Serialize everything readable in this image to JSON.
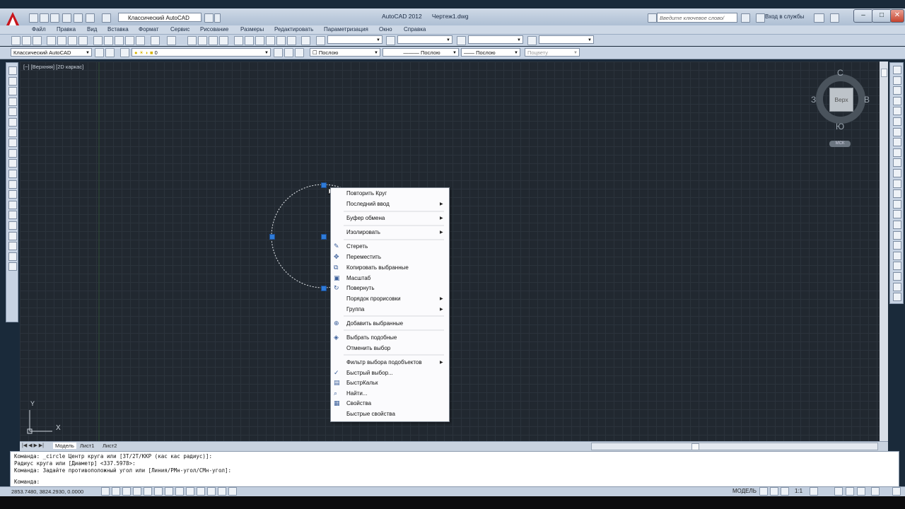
{
  "titlebar": {
    "app_name": "AutoCAD 2012",
    "document": "Чертеж1.dwg",
    "workspace": "Классический AutoCAD",
    "search_placeholder": "Введите ключевое слово/фразу",
    "login": "Вход в службы",
    "minimize": "–",
    "maximize": "□",
    "close": "✕"
  },
  "menubar": [
    "Файл",
    "Правка",
    "Вид",
    "Вставка",
    "Формат",
    "Сервис",
    "Рисование",
    "Размеры",
    "Редактировать",
    "Параметризация",
    "Окно",
    "Справка"
  ],
  "toolbar2": {
    "workspace": "Классический AutoCAD",
    "layer": "0",
    "color": "Послою",
    "linetype": "Послою",
    "lineweight": "Послою",
    "plotstyle": "Поцвету"
  },
  "viewport": {
    "label": "[−] [Верхняя] [2D каркас]"
  },
  "viewcube": {
    "north": "С",
    "south": "Ю",
    "east": "В",
    "west": "З",
    "face": "Верх",
    "wcs": "МСК"
  },
  "ucs": {
    "x": "X",
    "y": "Y"
  },
  "context_menu": {
    "items": [
      {
        "label": "Повторить Круг",
        "submenu": false
      },
      {
        "label": "Последний ввод",
        "submenu": true
      },
      {
        "label": "Буфер обмена",
        "submenu": true
      },
      {
        "label": "Изолировать",
        "submenu": true
      },
      {
        "label": "Стереть",
        "submenu": false,
        "icon": "eraser-icon"
      },
      {
        "label": "Переместить",
        "submenu": false,
        "icon": "move-icon"
      },
      {
        "label": "Копировать выбранные",
        "submenu": false,
        "icon": "copy-icon"
      },
      {
        "label": "Масштаб",
        "submenu": false,
        "icon": "scale-icon"
      },
      {
        "label": "Повернуть",
        "submenu": false,
        "icon": "rotate-icon"
      },
      {
        "label": "Порядок прорисовки",
        "submenu": true
      },
      {
        "label": "Группа",
        "submenu": true
      },
      {
        "label": "Добавить выбранные",
        "submenu": false,
        "icon": "add-selected-icon"
      },
      {
        "label": "Выбрать подобные",
        "submenu": false,
        "icon": "select-similar-icon"
      },
      {
        "label": "Отменить выбор",
        "submenu": false
      },
      {
        "label": "Фильтр выбора подобъектов",
        "submenu": true
      },
      {
        "label": "Быстрый выбор...",
        "submenu": false,
        "icon": "quick-select-icon"
      },
      {
        "label": "БыстрКальк",
        "submenu": false,
        "icon": "calculator-icon"
      },
      {
        "label": "Найти...",
        "submenu": false,
        "icon": "find-icon"
      },
      {
        "label": "Свойства",
        "submenu": false,
        "icon": "properties-icon"
      },
      {
        "label": "Быстрые свойства",
        "submenu": false
      }
    ]
  },
  "layout_tabs": [
    "Модель",
    "Лист1",
    "Лист2"
  ],
  "command_window": {
    "lines": [
      "Команда: _circle Центр круга или [3Т/2Т/ККР (кас кас радиус)]:",
      "Радиус круга или [Диаметр] <337.5978>:",
      "Команда: Задайте противоположный угол или [Линия/РМн-угол/СМн-угол]:"
    ],
    "prompt": "Команда:"
  },
  "statusbar": {
    "coords": "2853.7480, 3824.2930, 0.0000",
    "space": "МОДЕЛЬ",
    "scale": "1:1"
  },
  "colors": {
    "canvas": "#212830",
    "grid": "#2b333c",
    "grip": "#2f7bd8",
    "menu_bg": "#fbfbfd"
  }
}
